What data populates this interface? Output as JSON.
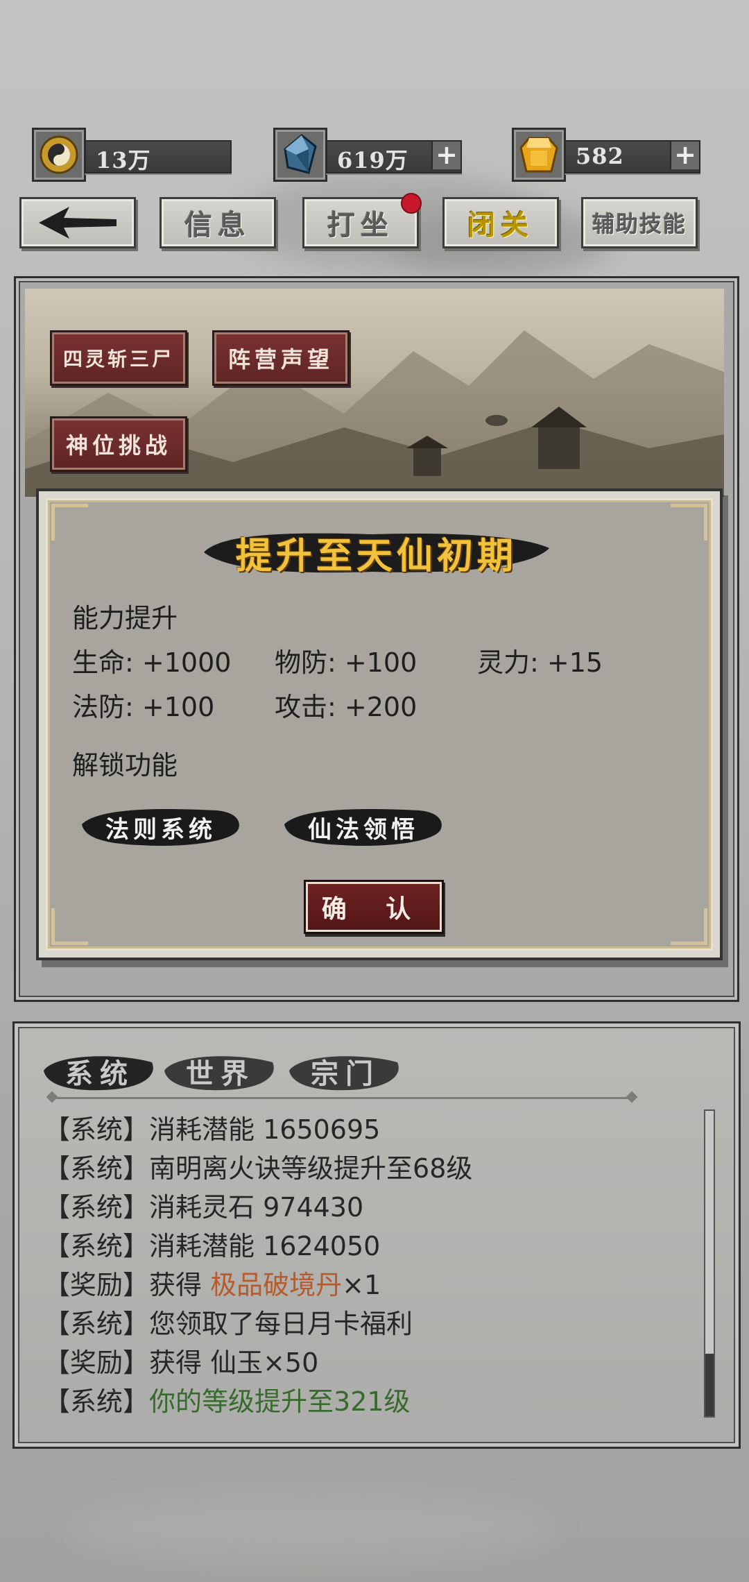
{
  "resources": [
    {
      "icon": "yin-yang-coin-icon",
      "value": "13万",
      "has_plus": false
    },
    {
      "icon": "blue-crystal-icon",
      "value": "619万",
      "has_plus": true
    },
    {
      "icon": "gold-gem-icon",
      "value": "582",
      "has_plus": true
    }
  ],
  "nav": {
    "back_icon": "arrow-left-icon",
    "info": "信息",
    "meditate": "打坐",
    "seclusion": "闭关",
    "assist_skills": "辅助技能"
  },
  "scene_buttons": {
    "btn1": "四灵斩三尸",
    "btn2": "阵营声望",
    "btn3": "神位挑战"
  },
  "dialog": {
    "title": "提升至天仙初期",
    "ability_heading": "能力提升",
    "stats": {
      "hp": "生命: +1000",
      "pdef": "物防: +100",
      "spirit": "灵力: +15",
      "mdef": "法防: +100",
      "atk": "攻击: +200"
    },
    "unlock_heading": "解锁功能",
    "unlocks": [
      "法则系统",
      "仙法领悟"
    ],
    "confirm": "确 认"
  },
  "log": {
    "tabs": [
      "系统",
      "世界",
      "宗门"
    ],
    "lines": [
      {
        "tag": "【系统】",
        "text": "消耗潜能 1650695",
        "hl": "",
        "suffix": ""
      },
      {
        "tag": "【系统】",
        "text": "南明离火诀等级提升至68级",
        "hl": "",
        "suffix": ""
      },
      {
        "tag": "【系统】",
        "text": "消耗灵石 974430",
        "hl": "",
        "suffix": ""
      },
      {
        "tag": "【系统】",
        "text": "消耗潜能 1624050",
        "hl": "",
        "suffix": ""
      },
      {
        "tag": "【奖励】",
        "text": "获得 ",
        "hl": "极品破境丹",
        "suffix": "×1"
      },
      {
        "tag": "【系统】",
        "text": "您领取了每日月卡福利",
        "hl": "",
        "suffix": ""
      },
      {
        "tag": "【奖励】",
        "text": "获得 仙玉×50",
        "hl": "",
        "suffix": ""
      },
      {
        "tag": "【系统】",
        "text": "",
        "hl_green": "你的等级提升至321级",
        "suffix": ""
      }
    ]
  },
  "colors": {
    "title_gold": "#f3c23c",
    "red_button": "#6e2222",
    "highlight_orange": "#b85a2a",
    "highlight_green": "#386a2e"
  }
}
